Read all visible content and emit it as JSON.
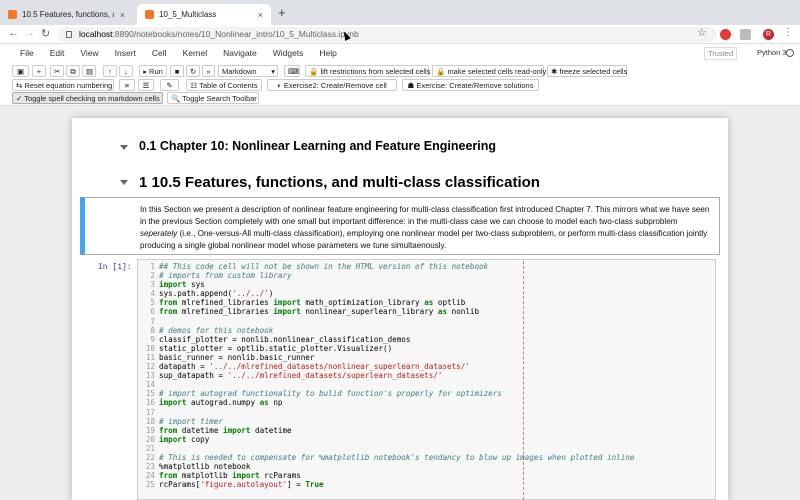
{
  "browser": {
    "tabs": [
      {
        "title": "10.5 Features, functions, and n",
        "active": false
      },
      {
        "title": "10_5_Multiclass",
        "active": true
      }
    ],
    "new_tab": "+",
    "url_host": "localhost",
    "url_rest": ":8890/notebooks/notes/10_Nonlinear_intro/10_5_Multiclass.ipynb",
    "profile_initial": "R"
  },
  "menu": {
    "items": [
      "File",
      "Edit",
      "View",
      "Insert",
      "Cell",
      "Kernel",
      "Navigate",
      "Widgets",
      "Help"
    ],
    "trusted": "Trusted",
    "kernel": "Python 3"
  },
  "toolbar": {
    "run": "Run",
    "cell_type": "Markdown",
    "lift": "lift restrictions from selected cells",
    "readonly": "make selected cells read-only",
    "freeze": "freeze selected cells",
    "reset_eq": "Reset equation numbering",
    "toc": "Table of Contents",
    "ex2": "Exercise2: Create/Remove cell",
    "ex": "Exercise: Create/Remove solutions",
    "spell": "Toggle spell checking on markdown cells",
    "search": "Toggle Search Toolbar"
  },
  "notebook": {
    "h2": "0.1  Chapter 10: Nonlinear Learning and Feature Engineering",
    "h1": "1  10.5 Features, functions, and multi-class classification",
    "md_before": "In this Section we present a description of nonlinear feature engineering for multi-class classification first introduced Chapter 7. This mirrors what we have seen in the previous Section completely with one small but important difference: in the multi-class case we can choose to model each two-class subproblem ",
    "md_em": "seperately",
    "md_after": " (i.e., One-versus-All multi-class classification), employing one nonlinear model per two-class subproblem, or perform multi-class classification jointly producing a single global nonlinear model whose parameters we tune simultaenously.",
    "prompt": "In [1]:",
    "code_lines": [
      "## This code cell will not be shown in the HTML version of this notebook",
      "# imports from custom library",
      "import sys",
      "sys.path.append('../../')",
      "from mlrefined_libraries import math_optimization_library as optlib",
      "from mlrefined_libraries import nonlinear_superlearn_library as nonlib",
      "",
      "# demos for this notebook",
      "classif_plotter = nonlib.nonlinear_classification_demos",
      "static_plotter = optlib.static_plotter.Visualizer()",
      "basic_runner = nonlib.basic_runner",
      "datapath = '../../mlrefined_datasets/nonlinear_superlearn_datasets/'",
      "sup_datapath = '../../mlrefined_datasets/superlearn_datasets/'",
      "",
      "# import autograd functionality to bulid function's properly for optimizers",
      "import autograd.numpy as np",
      "",
      "# import timer",
      "from datetime import datetime",
      "import copy",
      "",
      "# This is needed to compensate for %matplotlib notebook's tendancy to blow up images when plotted inline",
      "%matplotlib notebook",
      "from matplotlib import rcParams",
      "rcParams['figure.autolayout'] = True"
    ]
  }
}
